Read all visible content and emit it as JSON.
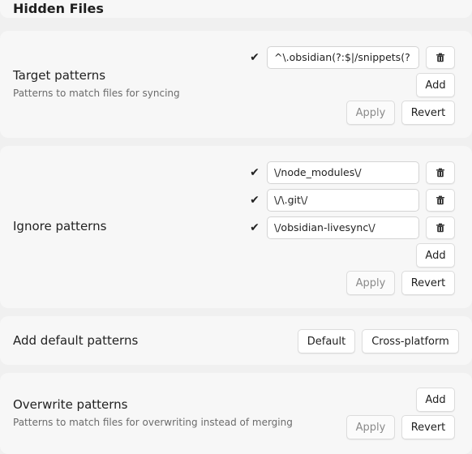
{
  "section_title": "Hidden Files",
  "target": {
    "label": "Target patterns",
    "description": "Patterns to match files for syncing",
    "patterns": [
      {
        "check": "✔",
        "value": "^\\.obsidian(?:$|/snippets(?"
      }
    ],
    "add_label": "Add",
    "apply_label": "Apply",
    "revert_label": "Revert"
  },
  "ignore": {
    "label": "Ignore patterns",
    "patterns": [
      {
        "check": "✔",
        "value": "\\/node_modules\\/"
      },
      {
        "check": "✔",
        "value": "\\/\\.git\\/"
      },
      {
        "check": "✔",
        "value": "\\/obsidian-livesync\\/"
      }
    ],
    "add_label": "Add",
    "apply_label": "Apply",
    "revert_label": "Revert"
  },
  "defaults": {
    "label": "Add default patterns",
    "default_label": "Default",
    "cross_platform_label": "Cross-platform"
  },
  "overwrite": {
    "label": "Overwrite patterns",
    "description": "Patterns to match files for overwriting instead of merging",
    "add_label": "Add",
    "apply_label": "Apply",
    "revert_label": "Revert"
  },
  "icons": {
    "delete": "trash-icon",
    "enabled": "checkmark-icon"
  }
}
